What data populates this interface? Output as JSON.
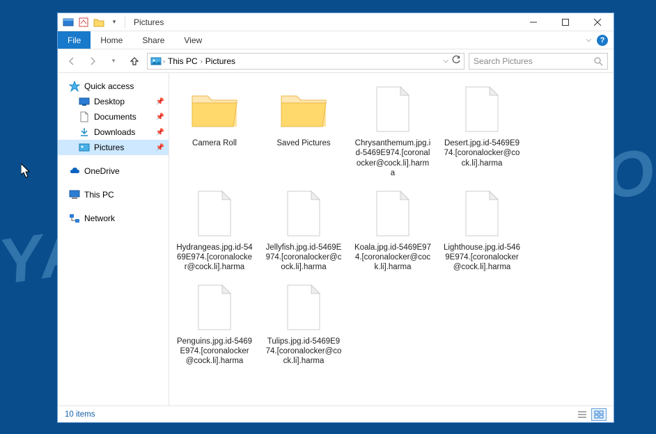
{
  "titlebar": {
    "title": "Pictures"
  },
  "ribbon": {
    "file": "File",
    "tabs": [
      "Home",
      "Share",
      "View"
    ]
  },
  "breadcrumb": {
    "segments": [
      "This PC",
      "Pictures"
    ]
  },
  "search": {
    "placeholder": "Search Pictures"
  },
  "nav": {
    "quick_access": {
      "label": "Quick access"
    },
    "quick_items": [
      {
        "label": "Desktop",
        "icon": "desktop"
      },
      {
        "label": "Documents",
        "icon": "documents"
      },
      {
        "label": "Downloads",
        "icon": "downloads"
      },
      {
        "label": "Pictures",
        "icon": "pictures",
        "selected": true
      }
    ],
    "onedrive": {
      "label": "OneDrive"
    },
    "thispc": {
      "label": "This PC"
    },
    "network": {
      "label": "Network"
    }
  },
  "items": [
    {
      "type": "folder",
      "label": "Camera Roll"
    },
    {
      "type": "folder",
      "label": "Saved Pictures"
    },
    {
      "type": "file",
      "label": "Chrysanthemum.jpg.id-5469E974.[coronalocker@cock.li].harma"
    },
    {
      "type": "file",
      "label": "Desert.jpg.id-5469E974.[coronalocker@cock.li].harma"
    },
    {
      "type": "file",
      "label": "Hydrangeas.jpg.id-5469E974.[coronalocker@cock.li].harma"
    },
    {
      "type": "file",
      "label": "Jellyfish.jpg.id-5469E974.[coronalocker@cock.li].harma"
    },
    {
      "type": "file",
      "label": "Koala.jpg.id-5469E974.[coronalocker@cock.li].harma"
    },
    {
      "type": "file",
      "label": "Lighthouse.jpg.id-5469E974.[coronalocker@cock.li].harma"
    },
    {
      "type": "file",
      "label": "Penguins.jpg.id-5469E974.[coronalocker@cock.li].harma"
    },
    {
      "type": "file",
      "label": "Tulips.jpg.id-5469E974.[coronalocker@cock.li].harma"
    }
  ],
  "statusbar": {
    "count": "10 items"
  }
}
